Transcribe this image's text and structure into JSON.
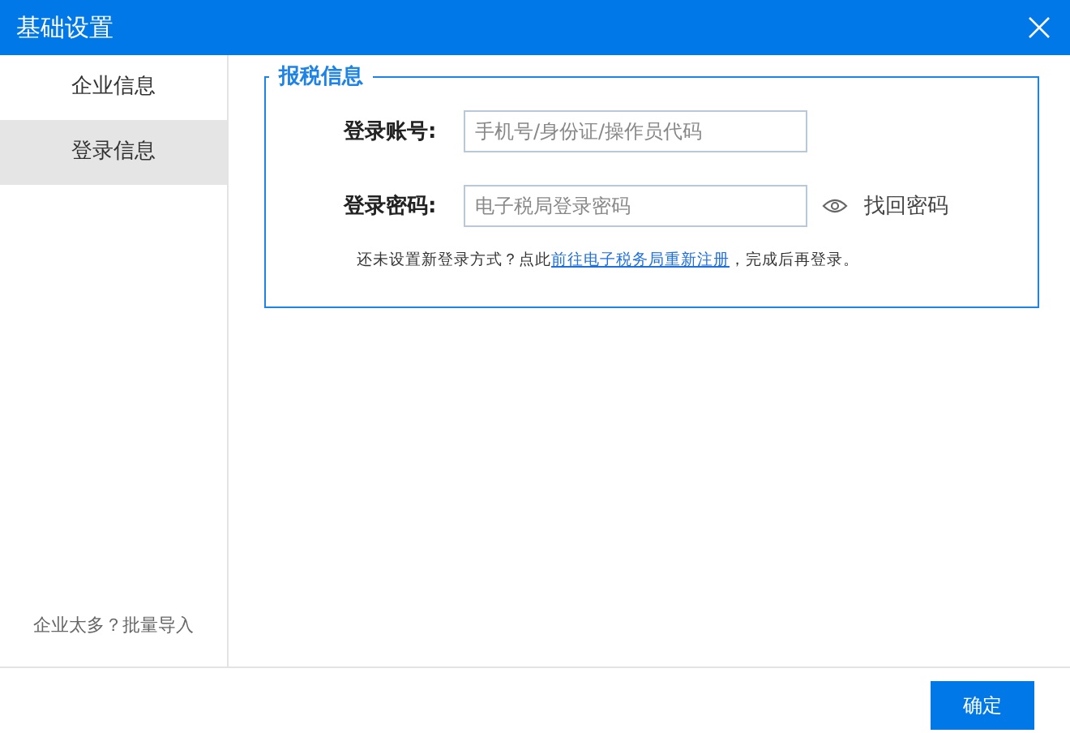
{
  "window": {
    "title": "基础设置"
  },
  "sidebar": {
    "items": [
      {
        "label": "企业信息",
        "selected": false
      },
      {
        "label": "登录信息",
        "selected": true
      }
    ],
    "footer_link": "企业太多？批量导入"
  },
  "section": {
    "title": "报税信息",
    "fields": [
      {
        "label": "登录账号:",
        "placeholder": "手机号/身份证/操作员代码",
        "kind": "text"
      },
      {
        "label": "登录密码:",
        "placeholder": "电子税局登录密码",
        "kind": "password",
        "extra_link": "找回密码"
      }
    ],
    "note": {
      "before": "还未设置新登录方式？点此",
      "link": "前往电子税务局重新注册",
      "after": "，完成后再登录。"
    }
  },
  "buttons": [
    "确定"
  ]
}
